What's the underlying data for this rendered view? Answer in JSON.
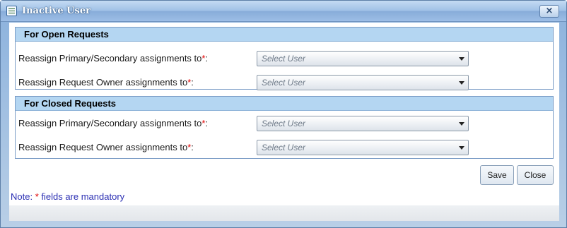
{
  "window": {
    "title": "Inactive User",
    "icon": "form-icon",
    "close_label": "×"
  },
  "open_requests": {
    "header": "For Open Requests",
    "rows": [
      {
        "label": "Reassign Primary/Secondary assignments to",
        "required_mark": "*",
        "suffix": ":",
        "placeholder": "Select User"
      },
      {
        "label": "Reassign Request Owner assignments to",
        "required_mark": "*",
        "suffix": ":",
        "placeholder": "Select User"
      }
    ]
  },
  "closed_requests": {
    "header": "For Closed Requests",
    "rows": [
      {
        "label": "Reassign Primary/Secondary assignments to",
        "required_mark": "*",
        "suffix": ":",
        "placeholder": "Select User"
      },
      {
        "label": "Reassign Request Owner assignments to",
        "required_mark": "*",
        "suffix": ":",
        "placeholder": "Select User"
      }
    ]
  },
  "buttons": {
    "save_label": "Save",
    "close_label": "Close"
  },
  "note": {
    "prefix": "Note: ",
    "star": "*",
    "text": " fields are mandatory"
  },
  "colors": {
    "required": "#e00000",
    "note_text": "#2b2fb3",
    "panel_header": "#b4d6f2",
    "titlebar": "#9fc0e6"
  }
}
